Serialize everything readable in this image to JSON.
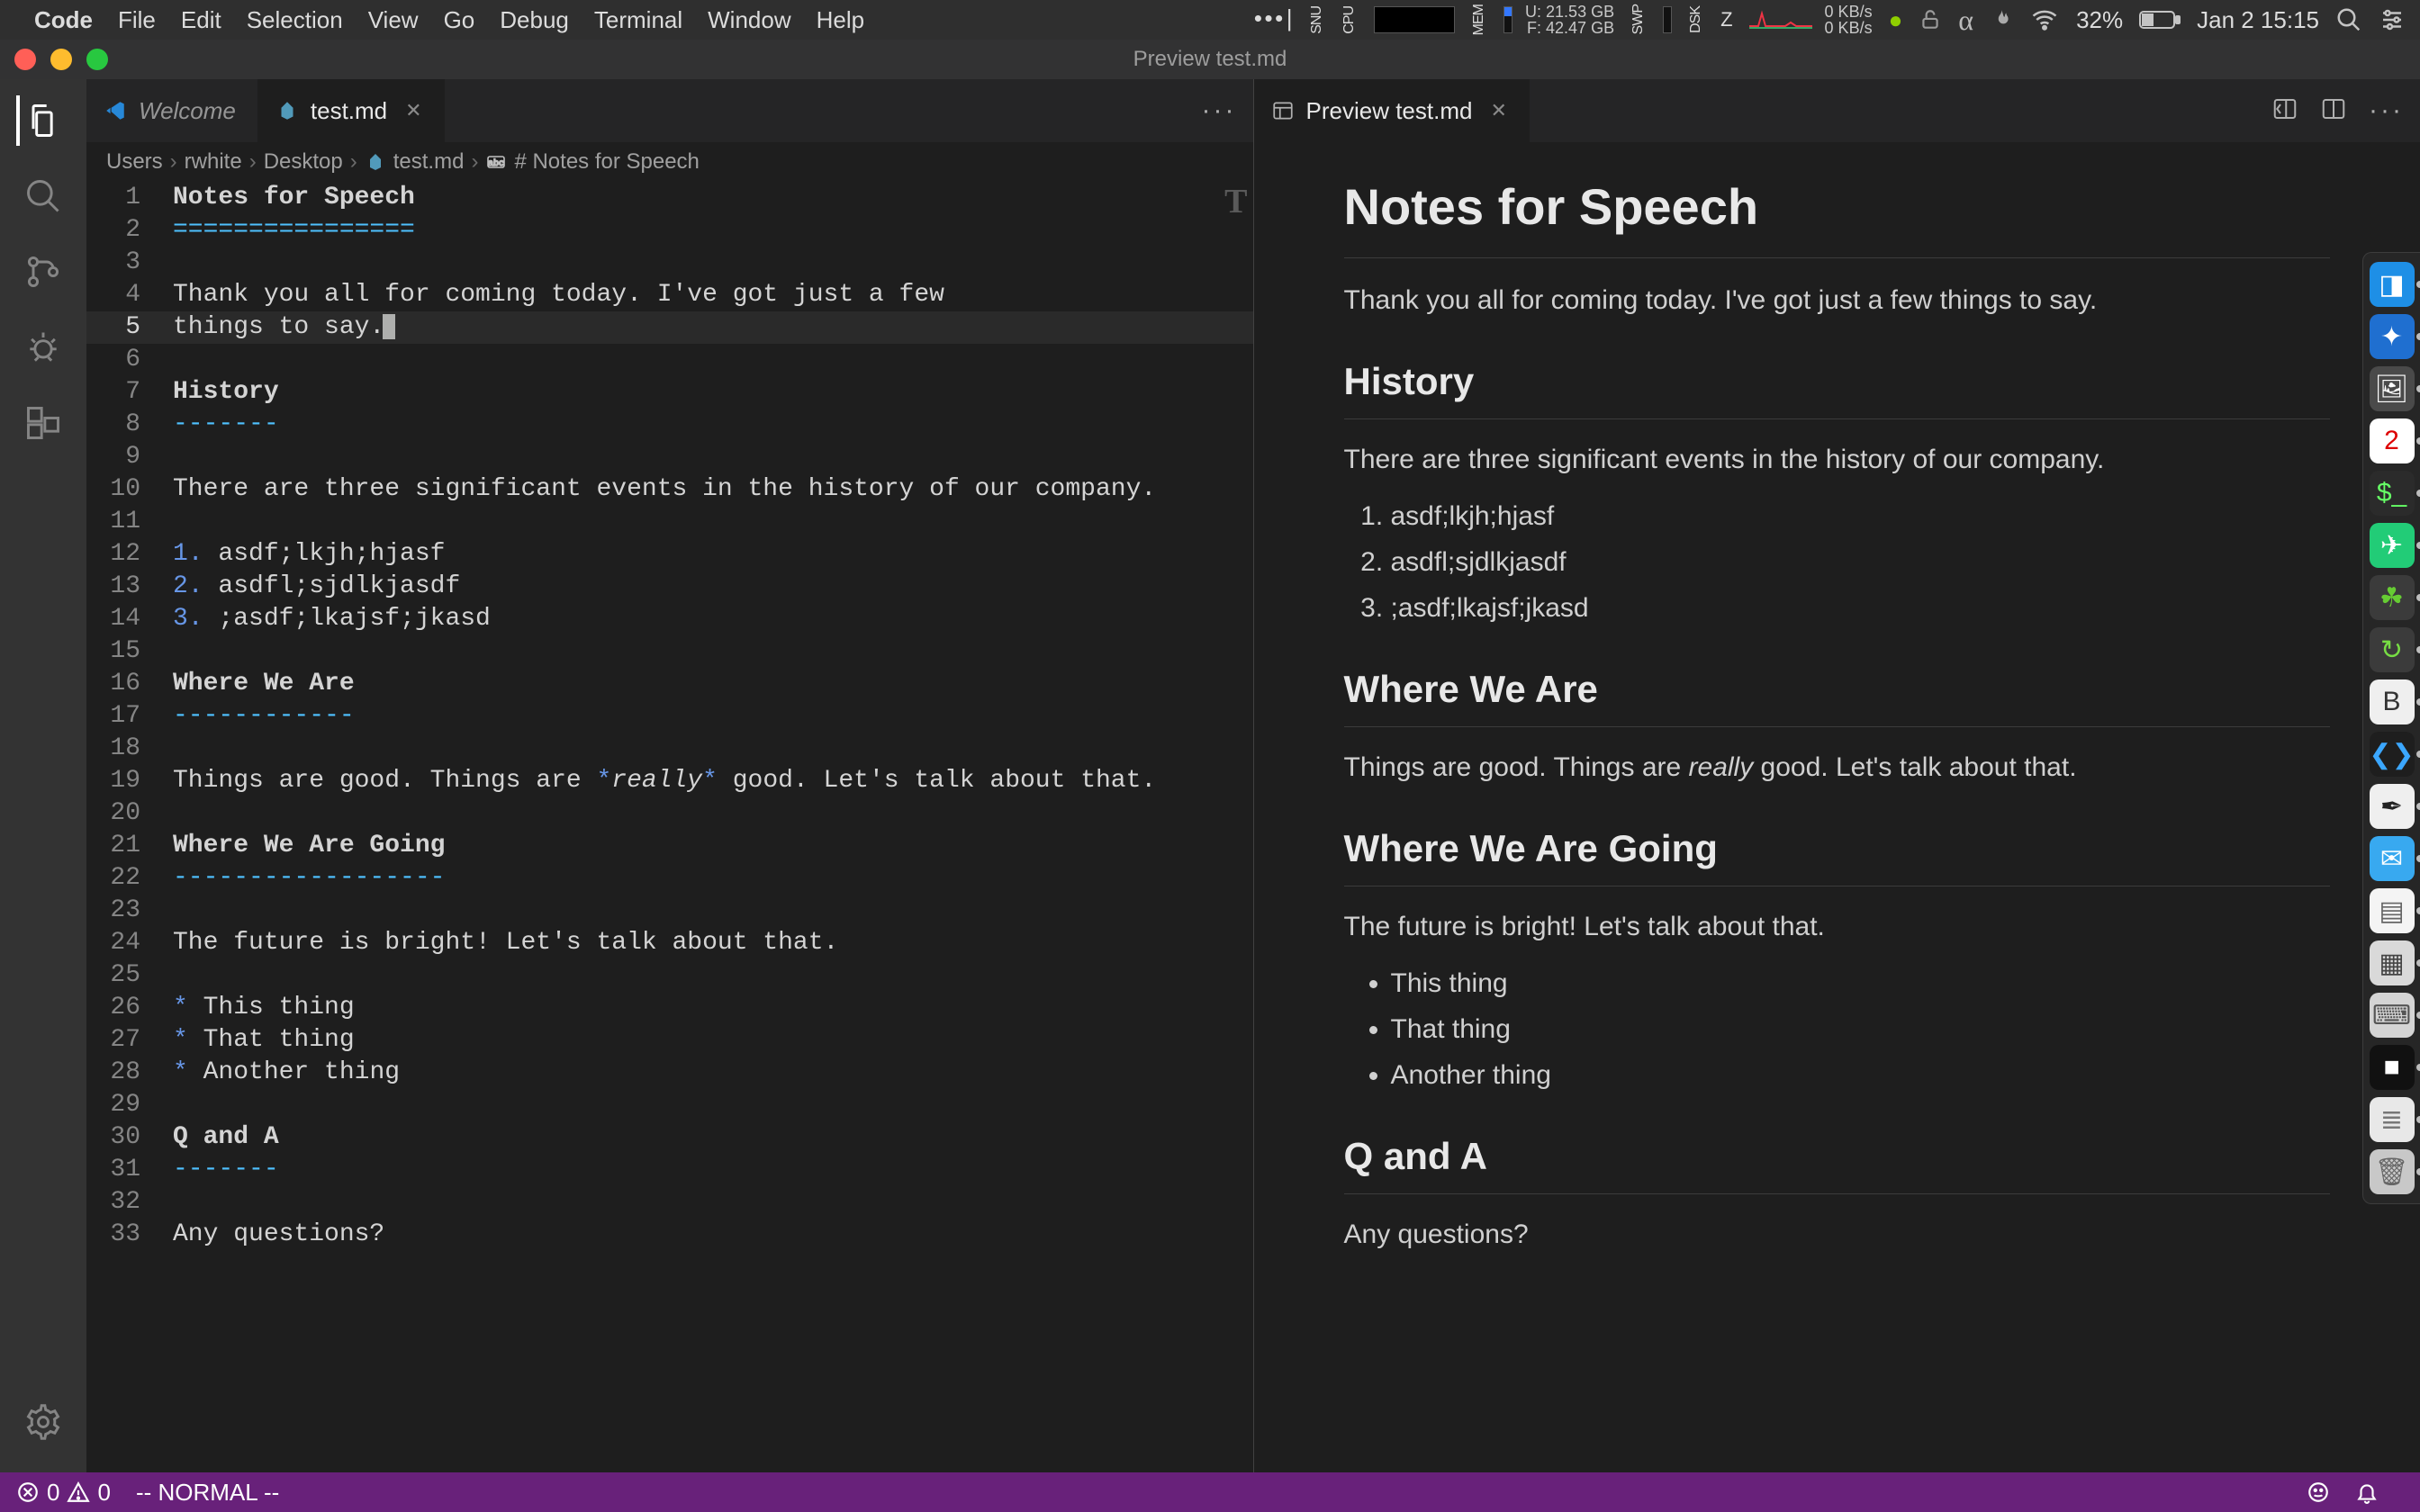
{
  "menubar": {
    "app_name": "Code",
    "items": [
      "File",
      "Edit",
      "Selection",
      "View",
      "Go",
      "Debug",
      "Terminal",
      "Window",
      "Help"
    ],
    "clock": "Jan 2  15:15",
    "battery_pct": "32%",
    "mem": {
      "label": "MEM",
      "u": "U:  21.53 GB",
      "f": "F:  42.47 GB"
    },
    "swap_label": "SWP",
    "disk_label": "DSK",
    "z_label": "Z",
    "net": {
      "down": "0 KB/s",
      "up": "0 KB/s"
    },
    "cpu_label": "CPU",
    "snu_label": "SNU"
  },
  "window_title": "Preview test.md",
  "tabs_left": [
    {
      "label": "Welcome",
      "icon": "vscode-icon",
      "active": false,
      "closeable": false
    },
    {
      "label": "test.md",
      "icon": "markdown-file-icon",
      "active": true,
      "closeable": true
    }
  ],
  "tabs_right": [
    {
      "label": "Preview test.md",
      "icon": "preview-icon",
      "active": true,
      "closeable": true
    }
  ],
  "breadcrumbs": [
    "Users",
    "rwhite",
    "Desktop",
    "test.md",
    "# Notes for Speech"
  ],
  "code_lines": [
    {
      "n": 1,
      "segs": [
        {
          "t": "Notes for Speech",
          "c": "tok-head"
        }
      ]
    },
    {
      "n": 2,
      "segs": [
        {
          "t": "================",
          "c": "tok-h1eq"
        }
      ]
    },
    {
      "n": 3,
      "segs": [
        {
          "t": ""
        }
      ]
    },
    {
      "n": 4,
      "segs": [
        {
          "t": "Thank you all for coming today. I've got just a few"
        }
      ]
    },
    {
      "n": 5,
      "segs": [
        {
          "t": "things to say."
        }
      ],
      "active": true,
      "cursor": true
    },
    {
      "n": 6,
      "segs": [
        {
          "t": ""
        }
      ]
    },
    {
      "n": 7,
      "segs": [
        {
          "t": "History",
          "c": "tok-head"
        }
      ]
    },
    {
      "n": 8,
      "segs": [
        {
          "t": "-------",
          "c": "tok-h2dash"
        }
      ]
    },
    {
      "n": 9,
      "segs": [
        {
          "t": ""
        }
      ]
    },
    {
      "n": 10,
      "segs": [
        {
          "t": "There are three significant events in the history of our company."
        }
      ]
    },
    {
      "n": 11,
      "segs": [
        {
          "t": ""
        }
      ]
    },
    {
      "n": 12,
      "segs": [
        {
          "t": "1.",
          "c": "tok-listnum"
        },
        {
          "t": " asdf;lkjh;hjasf"
        }
      ]
    },
    {
      "n": 13,
      "segs": [
        {
          "t": "2.",
          "c": "tok-listnum"
        },
        {
          "t": " asdfl;sjdlkjasdf"
        }
      ]
    },
    {
      "n": 14,
      "segs": [
        {
          "t": "3.",
          "c": "tok-listnum"
        },
        {
          "t": " ;asdf;lkajsf;jkasd"
        }
      ]
    },
    {
      "n": 15,
      "segs": [
        {
          "t": ""
        }
      ]
    },
    {
      "n": 16,
      "segs": [
        {
          "t": "Where We Are",
          "c": "tok-head"
        }
      ]
    },
    {
      "n": 17,
      "segs": [
        {
          "t": "------------",
          "c": "tok-h2dash"
        }
      ]
    },
    {
      "n": 18,
      "segs": [
        {
          "t": ""
        }
      ]
    },
    {
      "n": 19,
      "segs": [
        {
          "t": "Things are good. Things are "
        },
        {
          "t": "*",
          "c": "tok-bullet"
        },
        {
          "t": "really",
          "c": "tok-emph"
        },
        {
          "t": "*",
          "c": "tok-bullet"
        },
        {
          "t": " good. Let's talk about that."
        }
      ]
    },
    {
      "n": 20,
      "segs": [
        {
          "t": ""
        }
      ]
    },
    {
      "n": 21,
      "segs": [
        {
          "t": "Where We Are Going",
          "c": "tok-head"
        }
      ]
    },
    {
      "n": 22,
      "segs": [
        {
          "t": "------------------",
          "c": "tok-h2dash"
        }
      ]
    },
    {
      "n": 23,
      "segs": [
        {
          "t": ""
        }
      ]
    },
    {
      "n": 24,
      "segs": [
        {
          "t": "The future is bright! Let's talk about that."
        }
      ]
    },
    {
      "n": 25,
      "segs": [
        {
          "t": ""
        }
      ]
    },
    {
      "n": 26,
      "segs": [
        {
          "t": "*",
          "c": "tok-bullet"
        },
        {
          "t": " This thing"
        }
      ]
    },
    {
      "n": 27,
      "segs": [
        {
          "t": "*",
          "c": "tok-bullet"
        },
        {
          "t": " That thing"
        }
      ]
    },
    {
      "n": 28,
      "segs": [
        {
          "t": "*",
          "c": "tok-bullet"
        },
        {
          "t": " Another thing"
        }
      ]
    },
    {
      "n": 29,
      "segs": [
        {
          "t": ""
        }
      ]
    },
    {
      "n": 30,
      "segs": [
        {
          "t": "Q and A",
          "c": "tok-head"
        }
      ]
    },
    {
      "n": 31,
      "segs": [
        {
          "t": "-------",
          "c": "tok-h2dash"
        }
      ]
    },
    {
      "n": 32,
      "segs": [
        {
          "t": ""
        }
      ]
    },
    {
      "n": 33,
      "segs": [
        {
          "t": "Any questions?"
        }
      ]
    }
  ],
  "preview": {
    "title": "Notes for Speech",
    "intro": "Thank you all for coming today. I've got just a few things to say.",
    "h_history": "History",
    "history_p": "There are three significant events in the history of our company.",
    "history_list": [
      "asdf;lkjh;hjasf",
      "asdfl;sjdlkjasdf",
      ";asdf;lkajsf;jkasd"
    ],
    "h_where": "Where We Are",
    "where_p_pre": "Things are good. Things are ",
    "where_em": "really",
    "where_p_post": " good. Let's talk about that.",
    "h_going": "Where We Are Going",
    "going_p": "The future is bright! Let's talk about that.",
    "going_list": [
      "This thing",
      "That thing",
      "Another thing"
    ],
    "h_qa": "Q and A",
    "qa_p": "Any questions?"
  },
  "status_bar": {
    "errors": "0",
    "warnings": "0",
    "vim_mode": "-- NORMAL --"
  },
  "dock_items": [
    {
      "name": "finder",
      "bg": "#1e8fe6",
      "glyph": "◨"
    },
    {
      "name": "safari",
      "bg": "#1f6fd0",
      "glyph": "✦"
    },
    {
      "name": "preview",
      "bg": "#4a4a4a",
      "glyph": "🖼"
    },
    {
      "name": "calendar",
      "bg": "#ffffff",
      "glyph": "2",
      "fg": "#d00"
    },
    {
      "name": "terminal",
      "bg": "#2b2b2b",
      "glyph": "$_",
      "fg": "#6f6"
    },
    {
      "name": "maps",
      "bg": "#2c7",
      "glyph": "✈"
    },
    {
      "name": "leaf",
      "bg": "#3b3b3b",
      "glyph": "☘",
      "fg": "#6c3"
    },
    {
      "name": "cycle",
      "bg": "#3b3b3b",
      "glyph": "↻",
      "fg": "#7d4"
    },
    {
      "name": "b-app",
      "bg": "#efefef",
      "glyph": "B",
      "fg": "#333"
    },
    {
      "name": "vscode",
      "bg": "#1e1e1e",
      "glyph": "❮❯",
      "fg": "#3ba7ff"
    },
    {
      "name": "ink",
      "bg": "#efefef",
      "glyph": "✒",
      "fg": "#222"
    },
    {
      "name": "messages",
      "bg": "#38a9f0",
      "glyph": "✉"
    },
    {
      "name": "textedit",
      "bg": "#f4f4f4",
      "glyph": "▤",
      "fg": "#666"
    },
    {
      "name": "qr",
      "bg": "#d9d9d9",
      "glyph": "▦",
      "fg": "#444"
    },
    {
      "name": "keyboard",
      "bg": "#d4d4d4",
      "glyph": "⌨",
      "fg": "#555"
    },
    {
      "name": "dark-square",
      "bg": "#111",
      "glyph": "■"
    },
    {
      "name": "doc",
      "bg": "#e8e8e8",
      "glyph": "≣",
      "fg": "#777"
    },
    {
      "name": "trash",
      "bg": "#c8c8c8",
      "glyph": "🗑",
      "fg": "#666"
    }
  ]
}
